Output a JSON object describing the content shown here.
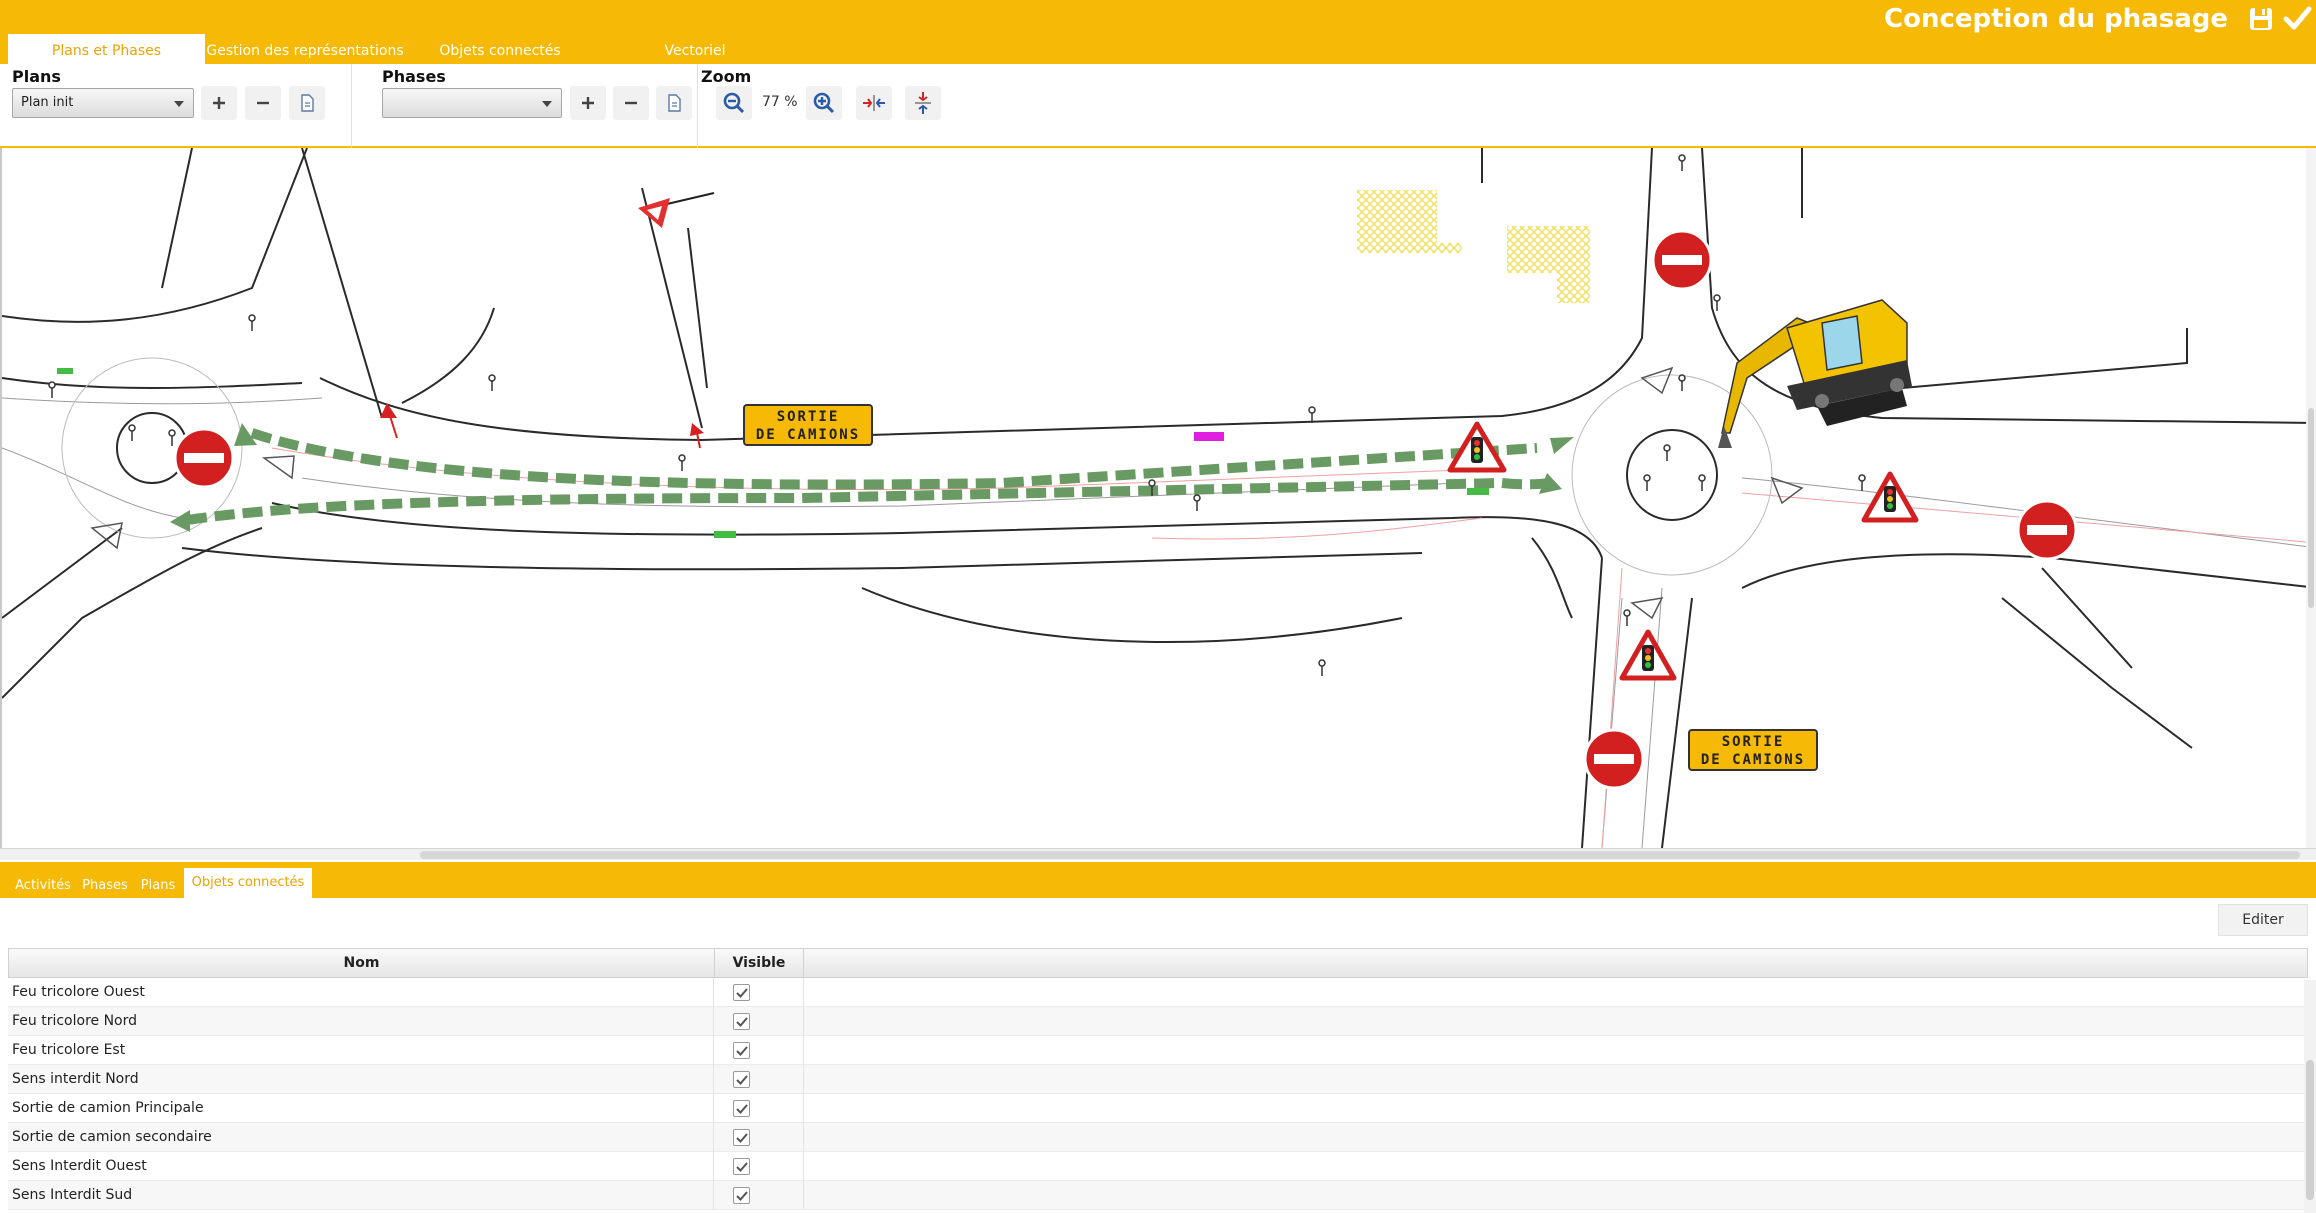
{
  "header": {
    "title": "Conception du phasage",
    "save_icon": "save-icon",
    "validate_icon": "checkmark-icon",
    "tabs": [
      {
        "label": "Plans et Phases",
        "active": true
      },
      {
        "label": "Gestion des représentations",
        "active": false
      },
      {
        "label": "Objets connectés",
        "active": false
      },
      {
        "label": "Vectoriel",
        "active": false
      }
    ]
  },
  "toolbar": {
    "plans": {
      "title": "Plans",
      "selected": "Plan init"
    },
    "phases": {
      "title": "Phases",
      "selected": ""
    },
    "zoom": {
      "title": "Zoom",
      "value": "77 %"
    }
  },
  "map": {
    "signs": [
      {
        "type": "sortie-camions",
        "line1": "SORTIE",
        "line2": "DE CAMIONS"
      },
      {
        "type": "sortie-camions",
        "line1": "SORTIE",
        "line2": "DE CAMIONS"
      }
    ],
    "colors": {
      "road": "#222222",
      "arrows": "#6a9a63",
      "sign_yellow": "#f6b905",
      "no_entry": "#d21f1f"
    }
  },
  "bottom_tabs": [
    {
      "label": "Activités",
      "active": false
    },
    {
      "label": "Phases",
      "active": false
    },
    {
      "label": "Plans",
      "active": false
    },
    {
      "label": "Objets connectés",
      "active": true
    }
  ],
  "panel": {
    "edit_label": "Editer",
    "columns": [
      "Nom",
      "Visible"
    ],
    "rows": [
      {
        "name": "Feu tricolore Ouest",
        "visible": true
      },
      {
        "name": "Feu tricolore Nord",
        "visible": true
      },
      {
        "name": "Feu tricolore Est",
        "visible": true
      },
      {
        "name": "Sens interdit Nord",
        "visible": true
      },
      {
        "name": "Sortie de camion Principale",
        "visible": true
      },
      {
        "name": "Sortie de camion secondaire",
        "visible": true
      },
      {
        "name": "Sens Interdit Ouest",
        "visible": true
      },
      {
        "name": "Sens Interdit Sud",
        "visible": true
      }
    ]
  }
}
